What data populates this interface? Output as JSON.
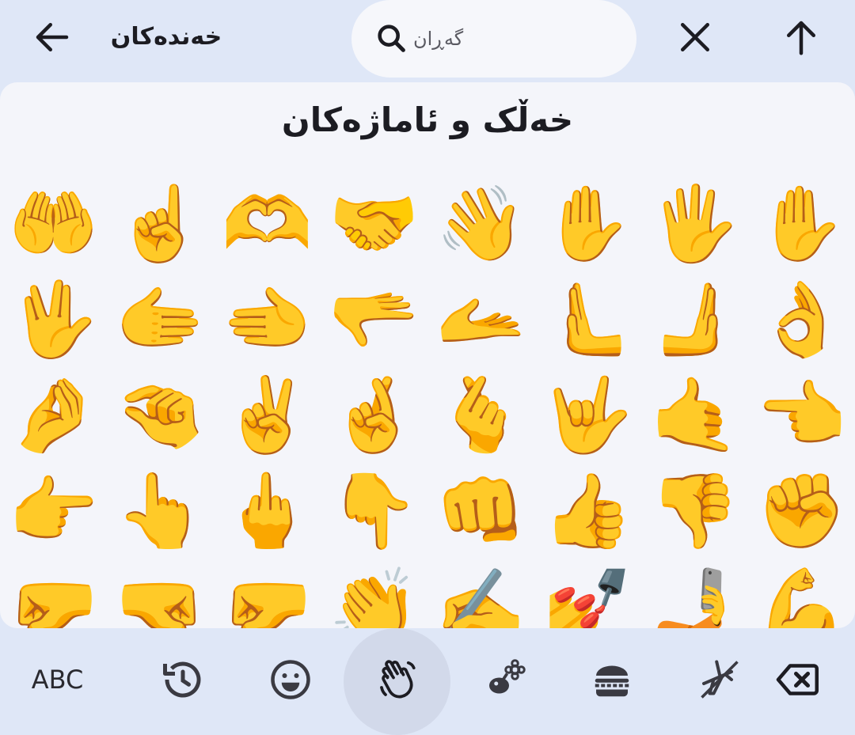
{
  "header": {
    "back_label": "خەندەکان",
    "search_placeholder": "گەڕان",
    "back_icon": "arrow-left-icon",
    "close_icon": "close-icon",
    "up_icon": "arrow-up-icon"
  },
  "panel": {
    "title": "خەڵک و ئاماژەکان",
    "emojis": [
      "🤲",
      "☝️",
      "🫶",
      "🤝",
      "👋",
      "✋",
      "🖐️",
      "✋",
      "🖖",
      "🫱",
      "🫲",
      "🫳",
      "🫴",
      "🫷",
      "🫸",
      "👌",
      "🤌",
      "🤏",
      "✌️",
      "🤞",
      "🫰",
      "🤟",
      "🤙",
      "👈",
      "👉",
      "👆",
      "🖕",
      "👇",
      "👊",
      "👍",
      "👎",
      "✊",
      "🤛",
      "🤜",
      "🤛",
      "👏",
      "✍️",
      "💅",
      "🤳",
      "💪"
    ]
  },
  "categories": {
    "abc_label": "ABC",
    "items": [
      "recent-icon",
      "smiley-icon",
      "waving-hand-icon",
      "flower-icon",
      "burger-icon",
      "airplane-icon",
      "backspace-icon"
    ],
    "active": "waving-hand-icon"
  },
  "colors": {
    "background": "#dfe7f7",
    "panel": "#f4f5fa",
    "search": "#f6f7fb",
    "active_category": "#d2d9ea",
    "icon": "#1c1c22"
  }
}
